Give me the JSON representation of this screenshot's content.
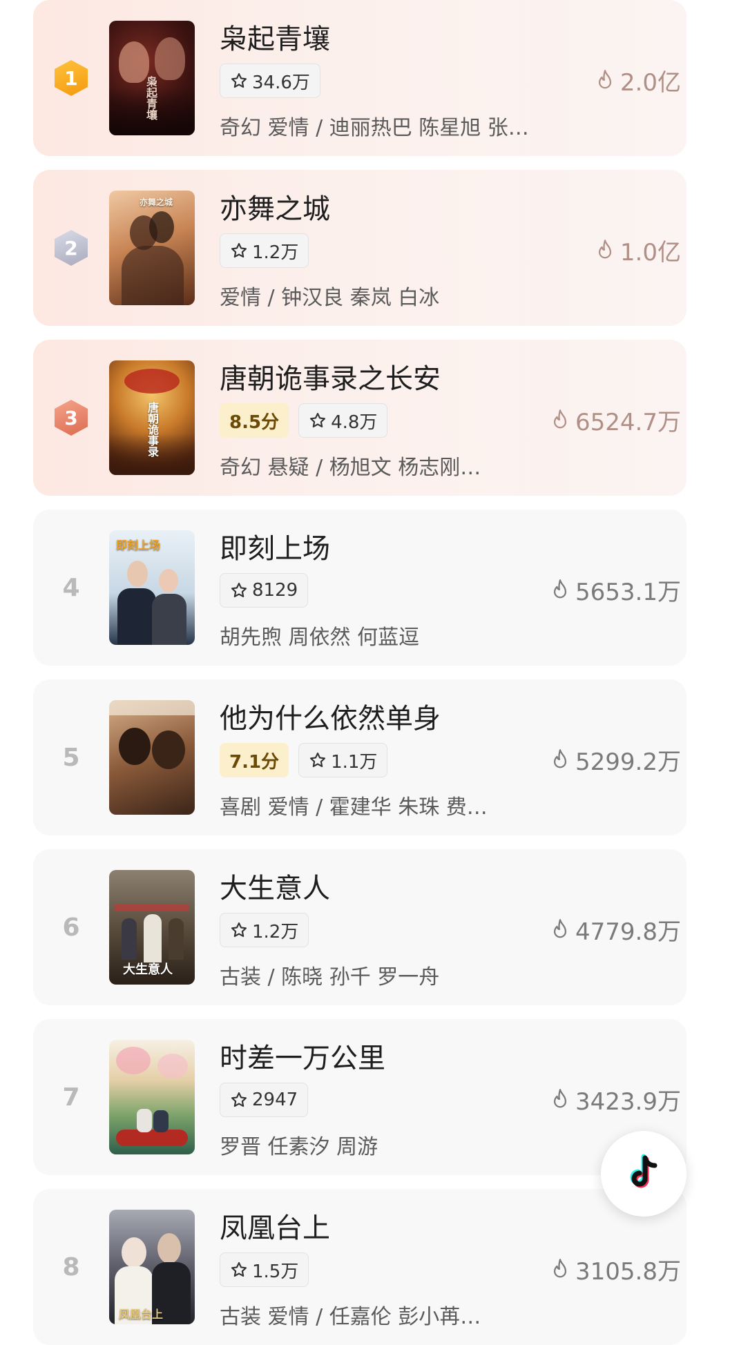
{
  "colors": {
    "accent_score_bg": "#fcefcc",
    "heat_top": "#b08f87"
  },
  "items": [
    {
      "rank": "1",
      "title": "枭起青壤",
      "score": "",
      "favorites": "34.6万",
      "meta": "奇幻 爱情 / 迪丽热巴 陈星旭 张…",
      "heat": "2.0亿"
    },
    {
      "rank": "2",
      "title": "亦舞之城",
      "score": "",
      "favorites": "1.2万",
      "meta": "爱情 / 钟汉良 秦岚 白冰",
      "heat": "1.0亿"
    },
    {
      "rank": "3",
      "title": "唐朝诡事录之长安",
      "score": "8.5分",
      "favorites": "4.8万",
      "meta": "奇幻 悬疑 / 杨旭文 杨志刚…",
      "heat": "6524.7万"
    },
    {
      "rank": "4",
      "title": "即刻上场",
      "score": "",
      "favorites": "8129",
      "meta": "胡先煦 周依然 何蓝逗",
      "heat": "5653.1万"
    },
    {
      "rank": "5",
      "title": "他为什么依然单身",
      "score": "7.1分",
      "favorites": "1.1万",
      "meta": "喜剧 爱情 / 霍建华 朱珠 费…",
      "heat": "5299.2万"
    },
    {
      "rank": "6",
      "title": "大生意人",
      "score": "",
      "favorites": "1.2万",
      "meta": "古装 / 陈晓 孙千 罗一舟",
      "heat": "4779.8万"
    },
    {
      "rank": "7",
      "title": "时差一万公里",
      "score": "",
      "favorites": "2947",
      "meta": "罗晋 任素汐 周游",
      "heat": "3423.9万"
    },
    {
      "rank": "8",
      "title": "凤凰台上",
      "score": "",
      "favorites": "1.5万",
      "meta": "古装 爱情 / 任嘉伦 彭小苒…",
      "heat": "3105.8万"
    }
  ],
  "posters": {
    "p1": "枭起青壤",
    "p2": "亦舞之城",
    "p3": "唐朝诡事录",
    "p4": "即刻上场",
    "p6": "大生意人",
    "p8": "凤凰台上"
  },
  "fab_icon": "tiktok-icon"
}
